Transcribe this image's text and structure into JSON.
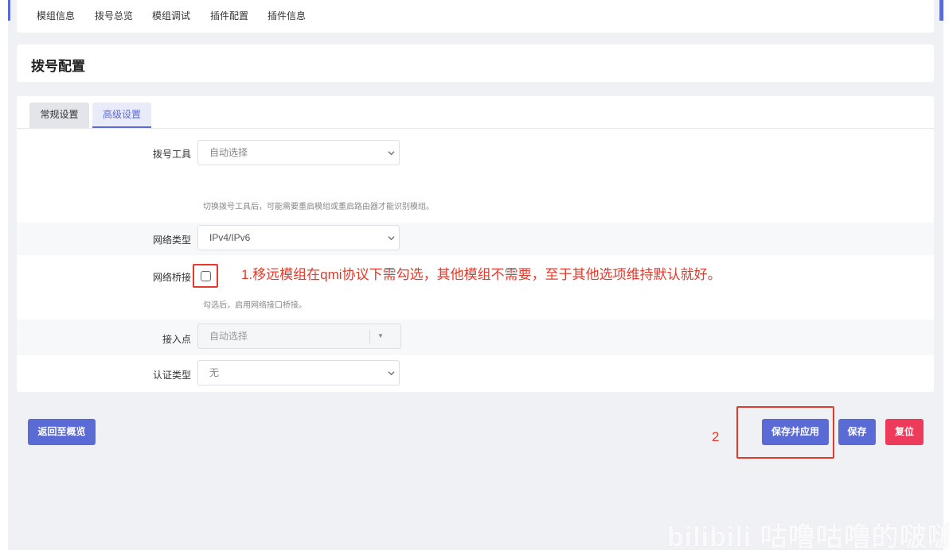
{
  "colors": {
    "accent": "#5b6bd5",
    "danger": "#ee3b5b",
    "annotation": "#e4392b",
    "background": "#f0f1f5"
  },
  "nav": {
    "items": [
      "模组信息",
      "拨号总览",
      "模组调试",
      "插件配置",
      "插件信息"
    ]
  },
  "page_title": "拨号配置",
  "tabs": [
    {
      "label": "常规设置",
      "active": false
    },
    {
      "label": "高级设置",
      "active": true
    }
  ],
  "form": {
    "dial_tool": {
      "label": "拨号工具",
      "value": "自动选择",
      "hint": "切换拨号工具后，可能需要重启模组或重启路由器才能识别模组。"
    },
    "network_type": {
      "label": "网络类型",
      "value": "IPv4/IPv6"
    },
    "network_bridge": {
      "label": "网络桥接",
      "checked": false,
      "hint": "勾选后，启用网络接口桥接。"
    },
    "apn": {
      "label": "接入点",
      "value": "自动选择",
      "icon": "triangle-down-icon"
    },
    "auth_type": {
      "label": "认证类型",
      "value": "无"
    }
  },
  "annotations": {
    "note1": "1.移远模组在qmi协议下需勾选，其他模组不需要，至于其他选项维持默认就好。",
    "note2": "2"
  },
  "buttons": {
    "back": "返回至概览",
    "save_apply": "保存并应用",
    "save": "保存",
    "reset": "复位"
  },
  "watermark": "bilibili 咕噜咕噜的啵啵"
}
